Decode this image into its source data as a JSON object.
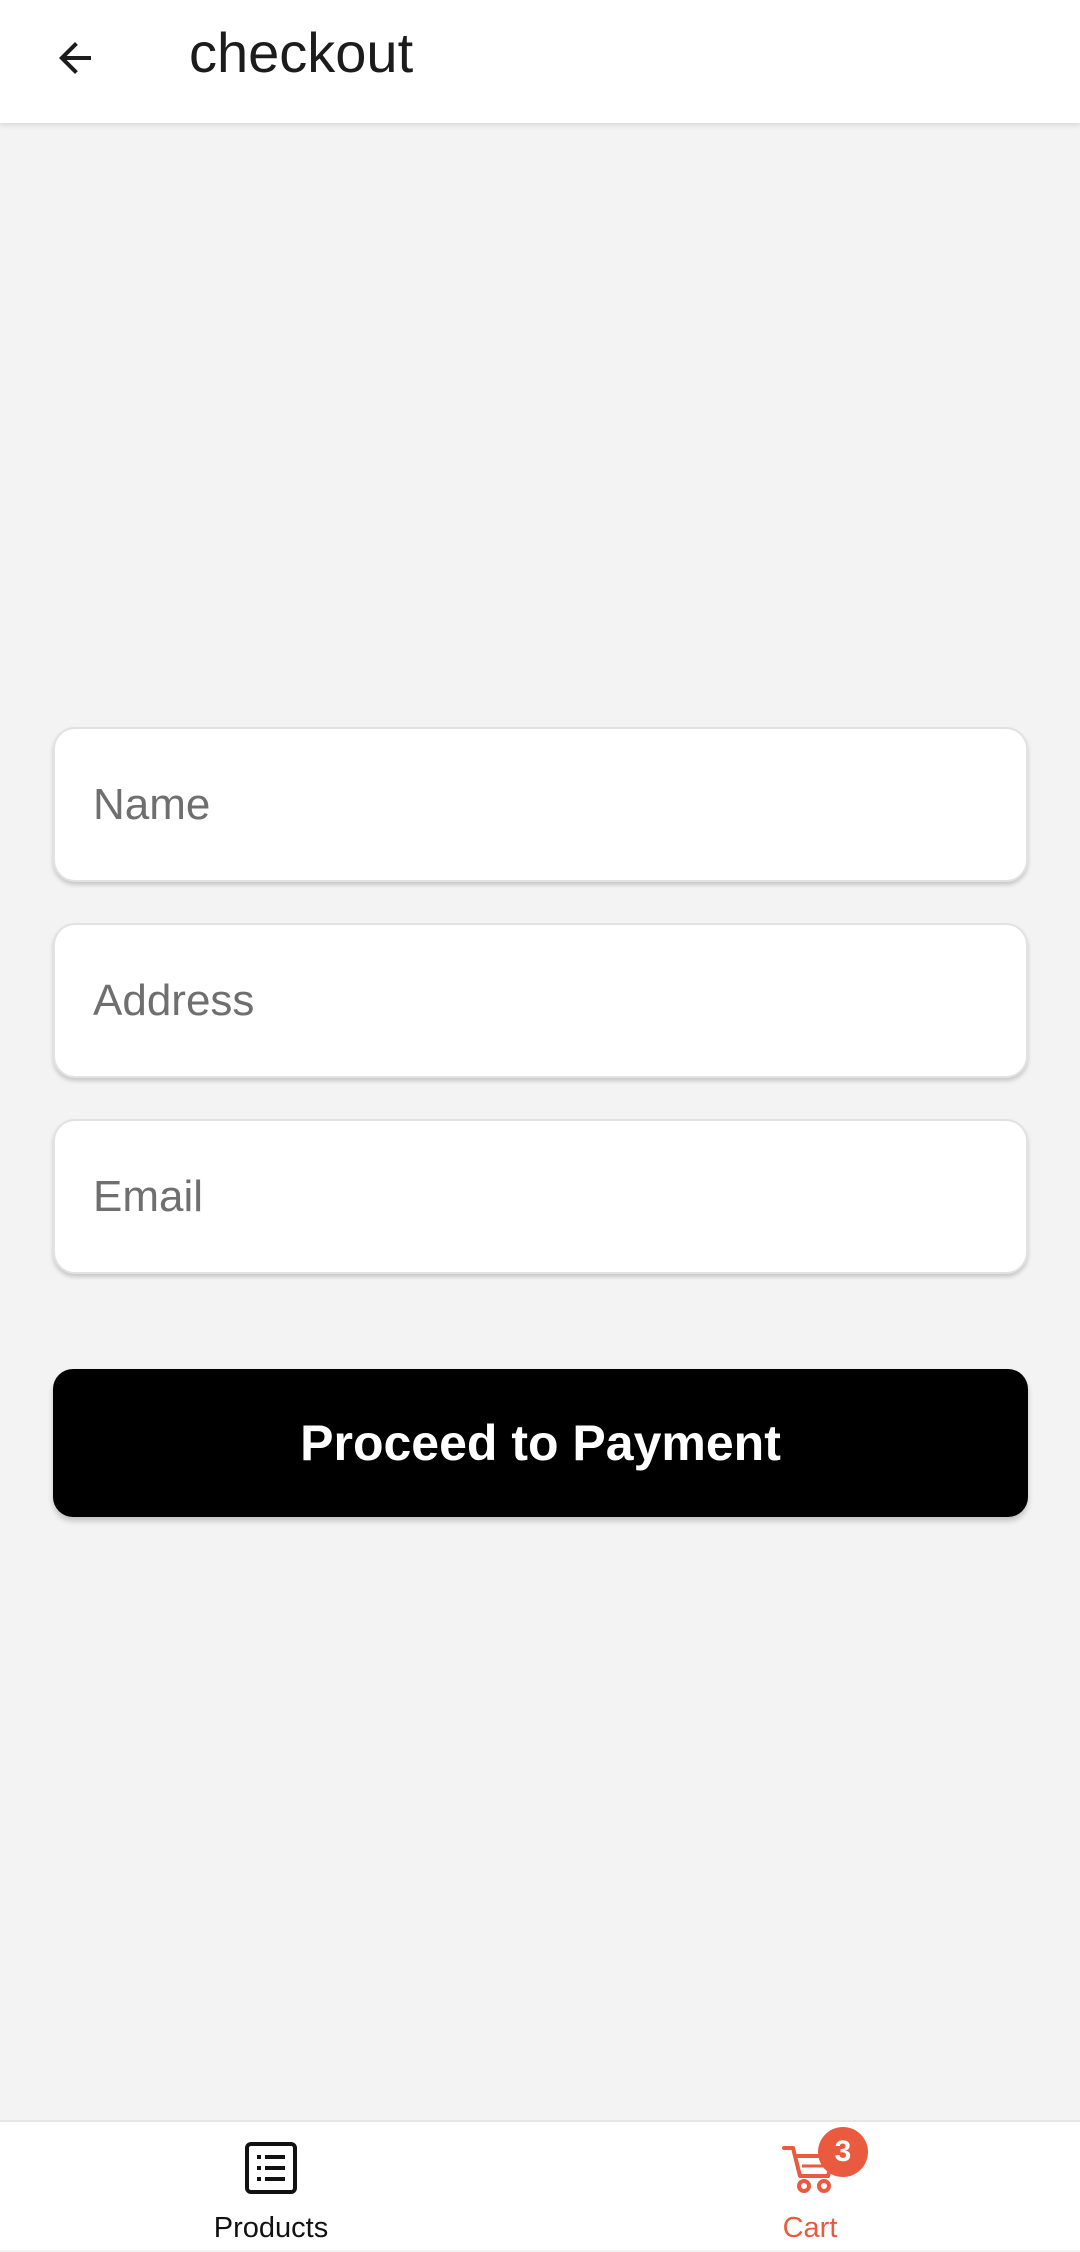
{
  "header": {
    "title": "checkout",
    "back_icon": "arrow-left-icon"
  },
  "form": {
    "name_placeholder": "Name",
    "address_placeholder": "Address",
    "email_placeholder": "Email",
    "name_value": "",
    "address_value": "",
    "email_value": ""
  },
  "actions": {
    "proceed_label": "Proceed to Payment"
  },
  "bottom_nav": {
    "products_label": "Products",
    "products_icon": "list-icon",
    "cart_label": "Cart",
    "cart_icon": "cart-icon",
    "cart_count": "3"
  },
  "colors": {
    "accent": "#ea5a3e",
    "background": "#f3f3f3",
    "button": "#000000"
  }
}
